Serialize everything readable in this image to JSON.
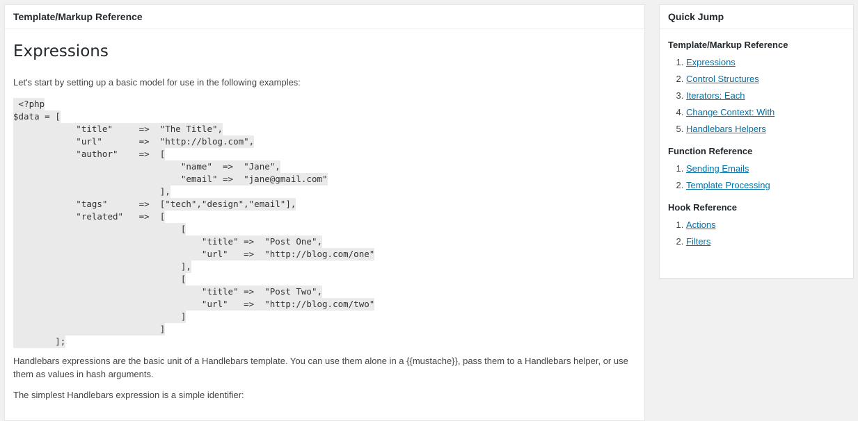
{
  "main": {
    "header": "Template/Markup Reference",
    "section_title": "Expressions",
    "intro": "Let's start by setting up a basic model for use in the following examples:",
    "code_lines": [
      " <?php",
      "$data = [",
      "            \"title\"     =>  \"The Title\",",
      "            \"url\"       =>  \"http://blog.com\",",
      "            \"author\"    =>  [",
      "                                \"name\"  =>  \"Jane\",",
      "                                \"email\" =>  \"jane@gmail.com\"",
      "                            ],",
      "            \"tags\"      =>  [\"tech\",\"design\",\"email\"],",
      "            \"related\"   =>  [",
      "                                [",
      "                                    \"title\" =>  \"Post One\",",
      "                                    \"url\"   =>  \"http://blog.com/one\"",
      "                                ],",
      "                                [",
      "                                    \"title\" =>  \"Post Two\",",
      "                                    \"url\"   =>  \"http://blog.com/two\"",
      "                                ]",
      "                            ]",
      "        ];"
    ],
    "paragraph_1": "Handlebars expressions are the basic unit of a Handlebars template. You can use them alone in a {{mustache}}, pass them to a Handlebars helper, or use them as values in hash arguments.",
    "paragraph_2": "The simplest Handlebars expression is a simple identifier:"
  },
  "sidebar": {
    "header": "Quick Jump",
    "sections": [
      {
        "title": "Template/Markup Reference",
        "items": [
          "Expressions",
          "Control Structures",
          "Iterators: Each",
          "Change Context: With",
          "Handlebars Helpers"
        ]
      },
      {
        "title": "Function Reference",
        "items": [
          "Sending Emails",
          "Template Processing"
        ]
      },
      {
        "title": "Hook Reference",
        "items": [
          "Actions",
          "Filters"
        ]
      }
    ]
  }
}
